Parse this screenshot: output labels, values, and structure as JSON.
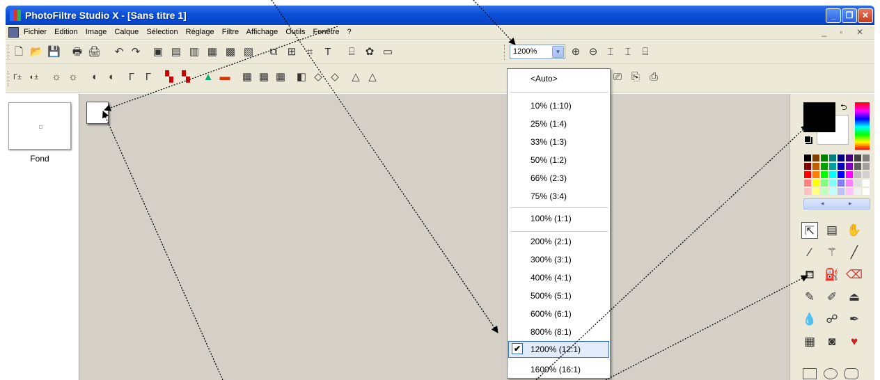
{
  "window": {
    "title": "PhotoFiltre Studio X - [Sans titre 1]",
    "minimize_icon": "minimize-icon",
    "restore_icon": "restore-icon",
    "close_icon": "close-icon"
  },
  "menu": {
    "items": [
      "Fichier",
      "Edition",
      "Image",
      "Calque",
      "Sélection",
      "Réglage",
      "Filtre",
      "Affichage",
      "Outils",
      "Fenêtre",
      "?"
    ]
  },
  "toolbar": {
    "zoom_value": "1200%"
  },
  "layers": {
    "items": [
      {
        "name": "Fond"
      }
    ]
  },
  "zoom_menu": {
    "items": [
      "<Auto>",
      "10%  (1:10)",
      "25%  (1:4)",
      "33%  (1:3)",
      "50%  (1:2)",
      "66%  (2:3)",
      "75%  (3:4)",
      "100%  (1:1)",
      "200%  (2:1)",
      "300%  (3:1)",
      "400%  (4:1)",
      "500%  (5:1)",
      "600%  (6:1)",
      "800%  (8:1)",
      "1200%  (12:1)",
      "1600%  (16:1)"
    ],
    "selected": "1200%  (12:1)"
  },
  "colors": {
    "foreground": "#000000",
    "background": "#ffffff",
    "titlebar": "#0a4fd8",
    "workspace": "#d4d0c8",
    "selection_border": "#3165c5"
  }
}
